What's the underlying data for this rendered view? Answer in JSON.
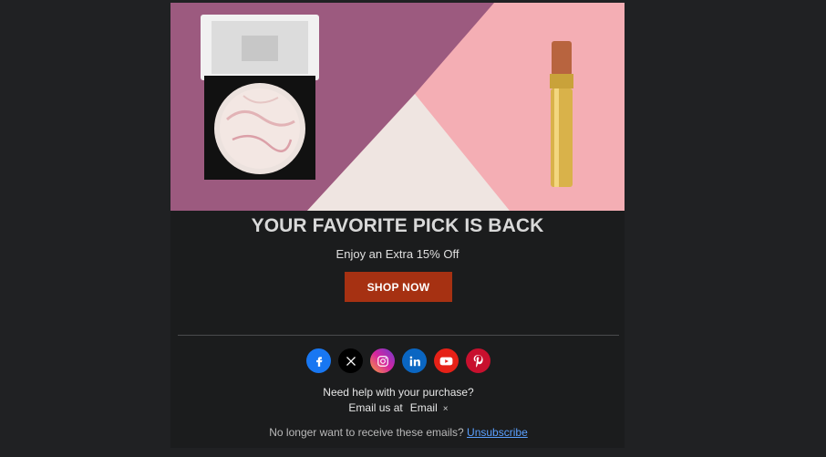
{
  "hero": {
    "image_alt": "makeup compact and lipstick product photo"
  },
  "headline": "YOUR FAVORITE PICK IS BACK",
  "subhead": "Enjoy an Extra 15% Off",
  "cta_label": "SHOP NOW",
  "social_icons": [
    {
      "name": "facebook-icon",
      "color": "#1877f2"
    },
    {
      "name": "x-icon",
      "color": "#000000"
    },
    {
      "name": "instagram-icon",
      "color": "#d6249f"
    },
    {
      "name": "linkedin-icon",
      "color": "#0a66c2"
    },
    {
      "name": "youtube-icon",
      "color": "#e62117"
    },
    {
      "name": "pinterest-icon",
      "color": "#c8102e"
    }
  ],
  "help": {
    "line1": "Need help with your purchase?",
    "line2_prefix": "Email us at",
    "email_chip": "Email",
    "chip_close": "×"
  },
  "footer": {
    "text": "No longer want to receive these emails?",
    "link": "Unsubscribe"
  },
  "colors": {
    "page_bg": "#202123",
    "email_bg": "#1b1c1d",
    "cta_bg": "#a63112",
    "link": "#5aa0ff"
  }
}
